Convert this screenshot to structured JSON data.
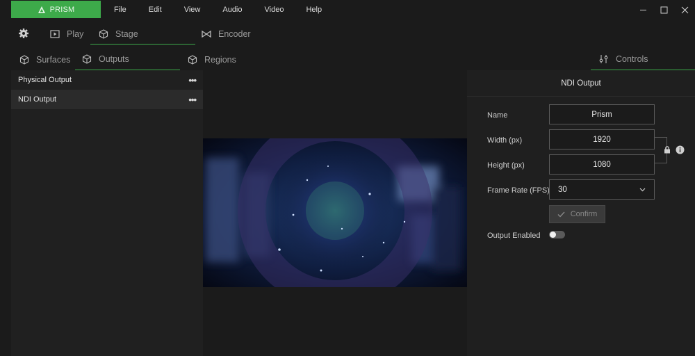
{
  "app": {
    "brand": "PRISM",
    "accent": "#3daa4a"
  },
  "menu": [
    "File",
    "Edit",
    "View",
    "Audio",
    "Video",
    "Help"
  ],
  "window_controls": [
    "minimize-icon",
    "maximize-icon",
    "close-icon"
  ],
  "main_tabs": [
    {
      "label": "Play",
      "icon": "play-icon"
    },
    {
      "label": "Stage",
      "icon": "cube-icon",
      "active": true
    },
    {
      "label": "Encoder",
      "icon": "bowtie-icon"
    }
  ],
  "sub_tabs": [
    {
      "label": "Surfaces",
      "icon": "cube-icon"
    },
    {
      "label": "Outputs",
      "icon": "cube-icon",
      "active": true
    },
    {
      "label": "Regions",
      "icon": "cube-icon"
    },
    {
      "label": "Controls",
      "icon": "sliders-icon",
      "active": true
    }
  ],
  "outputs": [
    {
      "label": "Physical Output",
      "more": "•••"
    },
    {
      "label": "NDI Output",
      "more": "•••",
      "selected": true
    }
  ],
  "controls": {
    "title": "NDI Output",
    "name_label": "Name",
    "name_value": "Prism",
    "width_label": "Width (px)",
    "width_value": "1920",
    "height_label": "Height (px)",
    "height_value": "1080",
    "fps_label": "Frame Rate (FPS)",
    "fps_value": "30",
    "confirm_label": "Confirm",
    "output_enabled_label": "Output Enabled",
    "output_enabled": false
  }
}
